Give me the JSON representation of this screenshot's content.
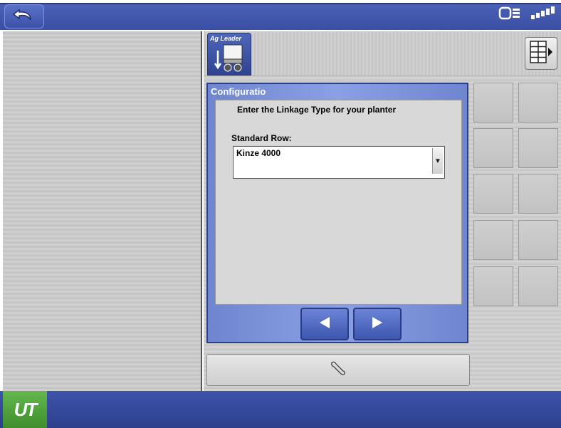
{
  "app_tab": {
    "brand": "Ag Leader"
  },
  "dialog": {
    "title": "Configuratio",
    "prompt": "Enter the Linkage Type for your planter",
    "field_label": "Standard Row:",
    "selected_value": "Kinze 4000"
  },
  "bottom": {
    "ut_label": "UT"
  },
  "icons": {
    "back": "back-arrow-icon",
    "status": [
      "display-icon",
      "gps-signal-icon"
    ],
    "grid": "grid-menu-icon",
    "prev": "left-arrow-icon",
    "next": "right-arrow-icon",
    "tool": "wrench-icon"
  },
  "colors": {
    "bar_blue": "#3a4fa3",
    "ut_green": "#4fa33d",
    "dialog_blue": "#7b92dd"
  }
}
